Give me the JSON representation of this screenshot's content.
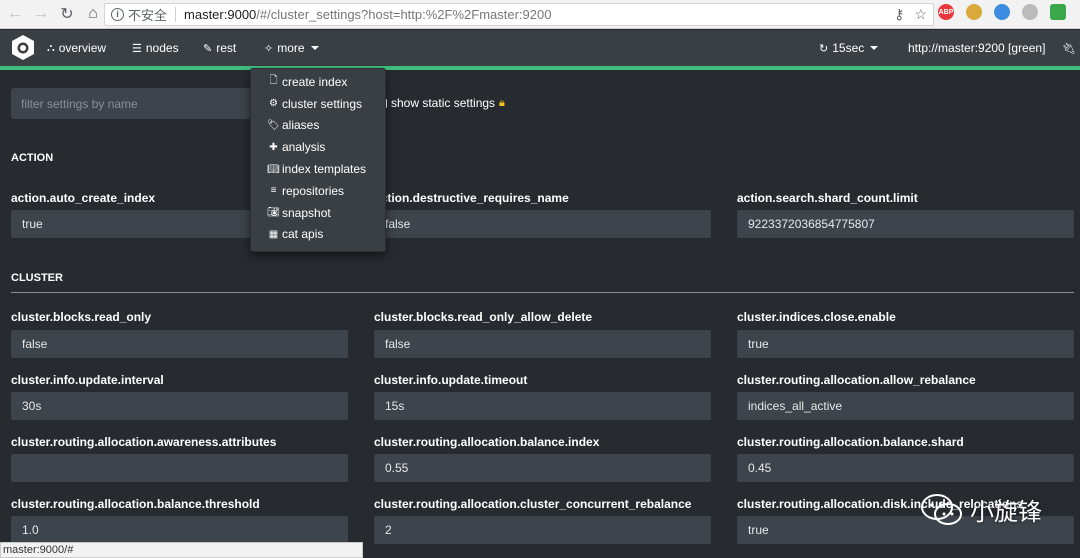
{
  "browser": {
    "security_label": "不安全",
    "url_host": "master:9000",
    "url_rest": "/#/cluster_settings?host=http:%2F%2Fmaster:9200",
    "extension_badges": {
      "abp": "ABP"
    }
  },
  "navbar": {
    "overview": "overview",
    "nodes": "nodes",
    "rest": "rest",
    "more": "more",
    "refresh": "15sec",
    "cluster": "http://master:9200 [green]",
    "accent_color": "#3fbf7f"
  },
  "dropdown": {
    "items": [
      {
        "label": "create index",
        "icon": "file-icon"
      },
      {
        "label": "cluster settings",
        "icon": "cogs-icon"
      },
      {
        "label": "aliases",
        "icon": "tags-icon"
      },
      {
        "label": "analysis",
        "icon": "puzzle-icon"
      },
      {
        "label": "index templates",
        "icon": "book-icon"
      },
      {
        "label": "repositories",
        "icon": "database-icon"
      },
      {
        "label": "snapshot",
        "icon": "camera-icon"
      },
      {
        "label": "cat apis",
        "icon": "table-icon"
      }
    ]
  },
  "filter": {
    "placeholder": "filter settings by name",
    "static_label": "show static settings"
  },
  "sections": {
    "action": {
      "title": "ACTION",
      "settings": [
        {
          "label": "action.auto_create_index",
          "value": "true"
        },
        {
          "label": "action.destructive_requires_name",
          "value": "false"
        },
        {
          "label": "action.search.shard_count.limit",
          "value": "9223372036854775807"
        }
      ]
    },
    "cluster": {
      "title": "CLUSTER",
      "settings": [
        {
          "label": "cluster.blocks.read_only",
          "value": "false"
        },
        {
          "label": "cluster.blocks.read_only_allow_delete",
          "value": "false"
        },
        {
          "label": "cluster.indices.close.enable",
          "value": "true"
        },
        {
          "label": "cluster.info.update.interval",
          "value": "30s"
        },
        {
          "label": "cluster.info.update.timeout",
          "value": "15s"
        },
        {
          "label": "cluster.routing.allocation.allow_rebalance",
          "value": "indices_all_active"
        },
        {
          "label": "cluster.routing.allocation.awareness.attributes",
          "value": ""
        },
        {
          "label": "cluster.routing.allocation.balance.index",
          "value": "0.55"
        },
        {
          "label": "cluster.routing.allocation.balance.shard",
          "value": "0.45"
        },
        {
          "label": "cluster.routing.allocation.balance.threshold",
          "value": "1.0"
        },
        {
          "label": "cluster.routing.allocation.cluster_concurrent_rebalance",
          "value": "2"
        },
        {
          "label": "cluster.routing.allocation.disk.include_relocations",
          "value": "true"
        }
      ]
    }
  },
  "statusbar": "master:9000/#",
  "watermark": "小旋锋"
}
